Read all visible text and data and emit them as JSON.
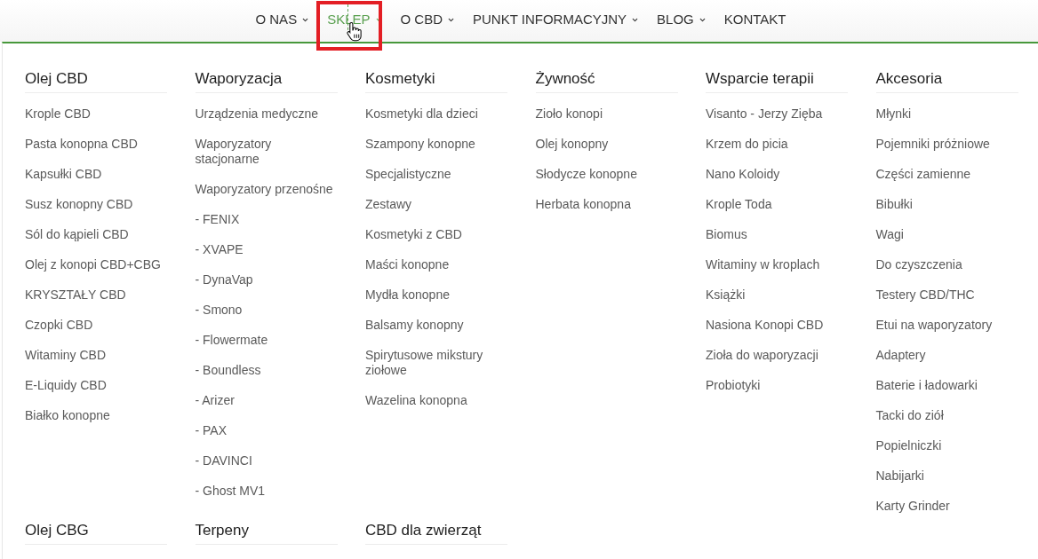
{
  "nav": [
    {
      "label": "O NAS",
      "has_submenu": true,
      "selected": false,
      "highlighted": false
    },
    {
      "label": "SKLEP",
      "has_submenu": true,
      "selected": true,
      "highlighted": true
    },
    {
      "label": "O CBD",
      "has_submenu": true,
      "selected": false,
      "highlighted": false
    },
    {
      "label": "PUNKT INFORMACYJNY",
      "has_submenu": true,
      "selected": false,
      "highlighted": false
    },
    {
      "label": "BLOG",
      "has_submenu": true,
      "selected": false,
      "highlighted": false
    },
    {
      "label": "KONTAKT",
      "has_submenu": false,
      "selected": false,
      "highlighted": false
    }
  ],
  "mega_menu": {
    "sections": [
      {
        "title": "Olej CBD",
        "items": [
          "Krople CBD",
          "Pasta konopna CBD",
          "Kapsułki CBD",
          "Susz konopny CBD",
          "Sól do kąpieli CBD",
          "Olej z konopi CBD+CBG",
          "KRYSZTAŁY CBD",
          "Czopki CBD",
          "Witaminy CBD",
          "E-Liquidy CBD",
          "Białko konopne"
        ]
      },
      {
        "title": "Waporyzacja",
        "items": [
          "Urządzenia medyczne",
          "Waporyzatory stacjonarne",
          "Waporyzatory przenośne",
          "- FENIX",
          "- XVAPE",
          "- DynaVap",
          "- Smono",
          "- Flowermate",
          "- Boundless",
          "- Arizer",
          "- PAX",
          "- DAVINCI",
          "- Ghost MV1"
        ]
      },
      {
        "title": "Kosmetyki",
        "items": [
          "Kosmetyki dla dzieci",
          "Szampony konopne",
          "Specjalistyczne",
          "Zestawy",
          "Kosmetyki z CBD",
          "Maści konopne",
          "Mydła konopne",
          "Balsamy konopny",
          "Spirytusowe mikstury ziołowe",
          "Wazelina konopna"
        ]
      },
      {
        "title": "Żywność",
        "items": [
          "Zioło konopi",
          "Olej konopny",
          "Słodycze konopne",
          "Herbata konopna"
        ]
      },
      {
        "title": "Wsparcie terapii",
        "items": [
          "Visanto - Jerzy Zięba",
          "Krzem do picia",
          "Nano Koloidy",
          "Krople Toda",
          "Biomus",
          "Witaminy w kroplach",
          "Książki",
          "Nasiona Konopi CBD",
          "Zioła do waporyzacji",
          "Probiotyki"
        ]
      },
      {
        "title": "Akcesoria",
        "items": [
          "Młynki",
          "Pojemniki próżniowe",
          "Części zamienne",
          "Bibułki",
          "Wagi",
          "Do czyszczenia",
          "Testery CBD/THC",
          "Etui na waporyzatory",
          "Adaptery",
          "Baterie i ładowarki",
          "Tacki do ziół",
          "Popielniczki",
          "Nabijarki",
          "Karty Grinder"
        ]
      },
      {
        "title": "Olej CBG"
      },
      {
        "title": "Terpeny"
      },
      {
        "title": "CBD dla zwierząt"
      }
    ]
  }
}
